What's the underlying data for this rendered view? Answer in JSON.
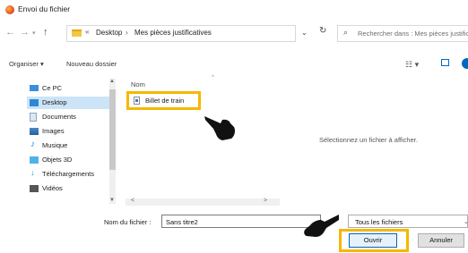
{
  "window": {
    "title": "Envoi du fichier",
    "icon": "firefox-icon"
  },
  "address_bar": {
    "back_icon": "arrow-left-icon",
    "forward_icon": "arrow-right-icon",
    "recent_icon": "chevron-down-icon",
    "up_icon": "arrow-up-icon",
    "prefix": "«",
    "crumbs": [
      "Desktop",
      "Mes pièces justificatives"
    ],
    "refresh_icon": "refresh-icon",
    "search_placeholder": "Rechercher dans : Mes pièces justificatives"
  },
  "toolbar": {
    "organize": "Organiser ▾",
    "new_folder": "Nouveau dossier"
  },
  "nav": {
    "items": [
      {
        "label": "Ce PC",
        "icon": "computer-icon",
        "color": "#3b8ede",
        "selected": false
      },
      {
        "label": "Desktop",
        "icon": "desktop-icon",
        "color": "#2f87d8",
        "selected": true
      },
      {
        "label": "Documents",
        "icon": "documents-icon",
        "color": "#8aa6c2",
        "selected": false
      },
      {
        "label": "Images",
        "icon": "images-icon",
        "color": "#4a8bc9",
        "selected": false
      },
      {
        "label": "Musique",
        "icon": "music-icon",
        "color": "#2f87d8",
        "selected": false
      },
      {
        "label": "Objets 3D",
        "icon": "cube-icon",
        "color": "#4fb3e8",
        "selected": false
      },
      {
        "label": "Téléchargements",
        "icon": "download-icon",
        "color": "#2f87d8",
        "selected": false
      },
      {
        "label": "Vidéos",
        "icon": "video-icon",
        "color": "#555555",
        "selected": false
      }
    ]
  },
  "file_list": {
    "column_name": "Nom",
    "files": [
      {
        "name": "Billet de train",
        "icon": "document-icon"
      }
    ]
  },
  "preview": {
    "message": "Sélectionnez un fichier à afficher."
  },
  "bottom": {
    "file_name_label": "Nom du fichier :",
    "file_name_value": "Sans titre2",
    "file_type": "Tous les fichiers",
    "open_label": "Ouvrir",
    "cancel_label": "Annuler"
  },
  "colors": {
    "highlight": "#f5b800",
    "accent": "#0067c0",
    "selected": "#cce4f7"
  }
}
